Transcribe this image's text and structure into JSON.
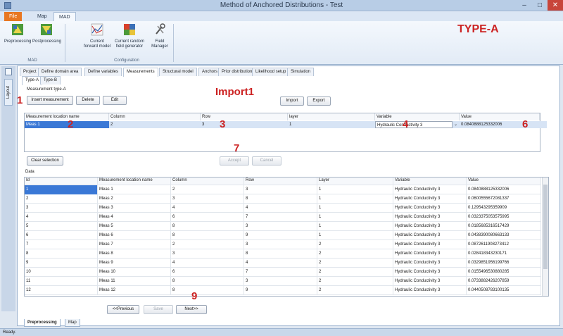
{
  "window": {
    "title": "Method of Anchored Distributions - Test"
  },
  "menu_tabs": [
    {
      "label": "File"
    },
    {
      "label": "Map"
    },
    {
      "label": "MAD"
    }
  ],
  "ribbon": {
    "buttons": [
      {
        "label_line1": "Preprocessing",
        "label_line2": ""
      },
      {
        "label_line1": "Postprocessing",
        "label_line2": ""
      },
      {
        "label_line1": "Current",
        "label_line2": "forward model"
      },
      {
        "label_line1": "Current random",
        "label_line2": "field generator"
      },
      {
        "label_line1": "Field",
        "label_line2": "Manager"
      }
    ],
    "groups": [
      {
        "label": "MAD"
      },
      {
        "label": "Configuration"
      }
    ]
  },
  "annotations": {
    "type_a": "TYPE-A",
    "import1": "Import1",
    "n1": "1",
    "n2": "2",
    "n3": "3",
    "n4": "4",
    "n6": "6",
    "n7": "7",
    "n9": "9"
  },
  "side_panel": {
    "label": "Layout"
  },
  "main_tabs": [
    {
      "label": "Project"
    },
    {
      "label": "Define domain area"
    },
    {
      "label": "Define variables"
    },
    {
      "label": "Measurements"
    },
    {
      "label": "Structural model"
    },
    {
      "label": "Anchors"
    },
    {
      "label": "Prior distribution"
    },
    {
      "label": "Likelihood setup"
    },
    {
      "label": "Simulation"
    }
  ],
  "sub_tabs": [
    {
      "label": "Type-A"
    },
    {
      "label": "Type-B"
    }
  ],
  "measurement_group": {
    "title": "Measurement type-A",
    "insert_label": "Insert measurement",
    "delete_label": "Delete",
    "edit_label": "Edit",
    "import_label": "Import",
    "export_label": "Export"
  },
  "edit_grid": {
    "headers": [
      "Measurement location name",
      "Column",
      "Row",
      "layer",
      "Variable",
      "Value"
    ],
    "row": {
      "name": "Meas 1",
      "column": "2",
      "row": "3",
      "layer": "1",
      "variable": "Hydraulic Conductivity 3",
      "value": "0.0840888125332006"
    }
  },
  "clear_selection_label": "Clear selection",
  "accept_label": "Accept",
  "cancel_label": "Cancel",
  "data_label": "Data",
  "data_grid": {
    "headers": [
      "Id",
      "Measurement location name",
      "Column",
      "Row",
      "Layer",
      "Variable",
      "Value"
    ],
    "rows": [
      [
        "1",
        "Meas 1",
        "2",
        "3",
        "1",
        "Hydraulic Conductivity 3",
        "0.0840888125332006"
      ],
      [
        "2",
        "Meas 2",
        "3",
        "8",
        "1",
        "Hydraulic Conductivity 3",
        "0.0600555672081337"
      ],
      [
        "3",
        "Meas 3",
        "4",
        "4",
        "1",
        "Hydraulic Conductivity 3",
        "0.129543295359909"
      ],
      [
        "4",
        "Meas 4",
        "6",
        "7",
        "1",
        "Hydraulic Conductivity 3",
        "0.0323375053575995"
      ],
      [
        "5",
        "Meas 5",
        "8",
        "3",
        "1",
        "Hydraulic Conductivity 3",
        "0.0185685316517429"
      ],
      [
        "6",
        "Meas 6",
        "8",
        "9",
        "1",
        "Hydraulic Conductivity 3",
        "0.0438390080663133"
      ],
      [
        "7",
        "Meas 7",
        "2",
        "3",
        "2",
        "Hydraulic Conductivity 3",
        "0.0872611908273412"
      ],
      [
        "8",
        "Meas 8",
        "3",
        "8",
        "2",
        "Hydraulic Conductivity 3",
        "0.028418343230171"
      ],
      [
        "9",
        "Meas 9",
        "4",
        "4",
        "2",
        "Hydraulic Conductivity 3",
        "0.0329851956199766"
      ],
      [
        "10",
        "Meas 10",
        "6",
        "7",
        "2",
        "Hydraulic Conductivity 3",
        "0.0155496530880285"
      ],
      [
        "11",
        "Meas 11",
        "8",
        "3",
        "2",
        "Hydraulic Conductivity 3",
        "0.0733882426207859"
      ],
      [
        "12",
        "Meas 12",
        "8",
        "9",
        "2",
        "Hydraulic Conductivity 3",
        "0.0440508783100135"
      ]
    ]
  },
  "nav": {
    "previous_label": "<<Previous",
    "save_label": "Save",
    "next_label": "Next>>"
  },
  "bottom_tabs": [
    {
      "label": "Preprocessing"
    },
    {
      "label": "Map"
    }
  ],
  "status": "Ready."
}
